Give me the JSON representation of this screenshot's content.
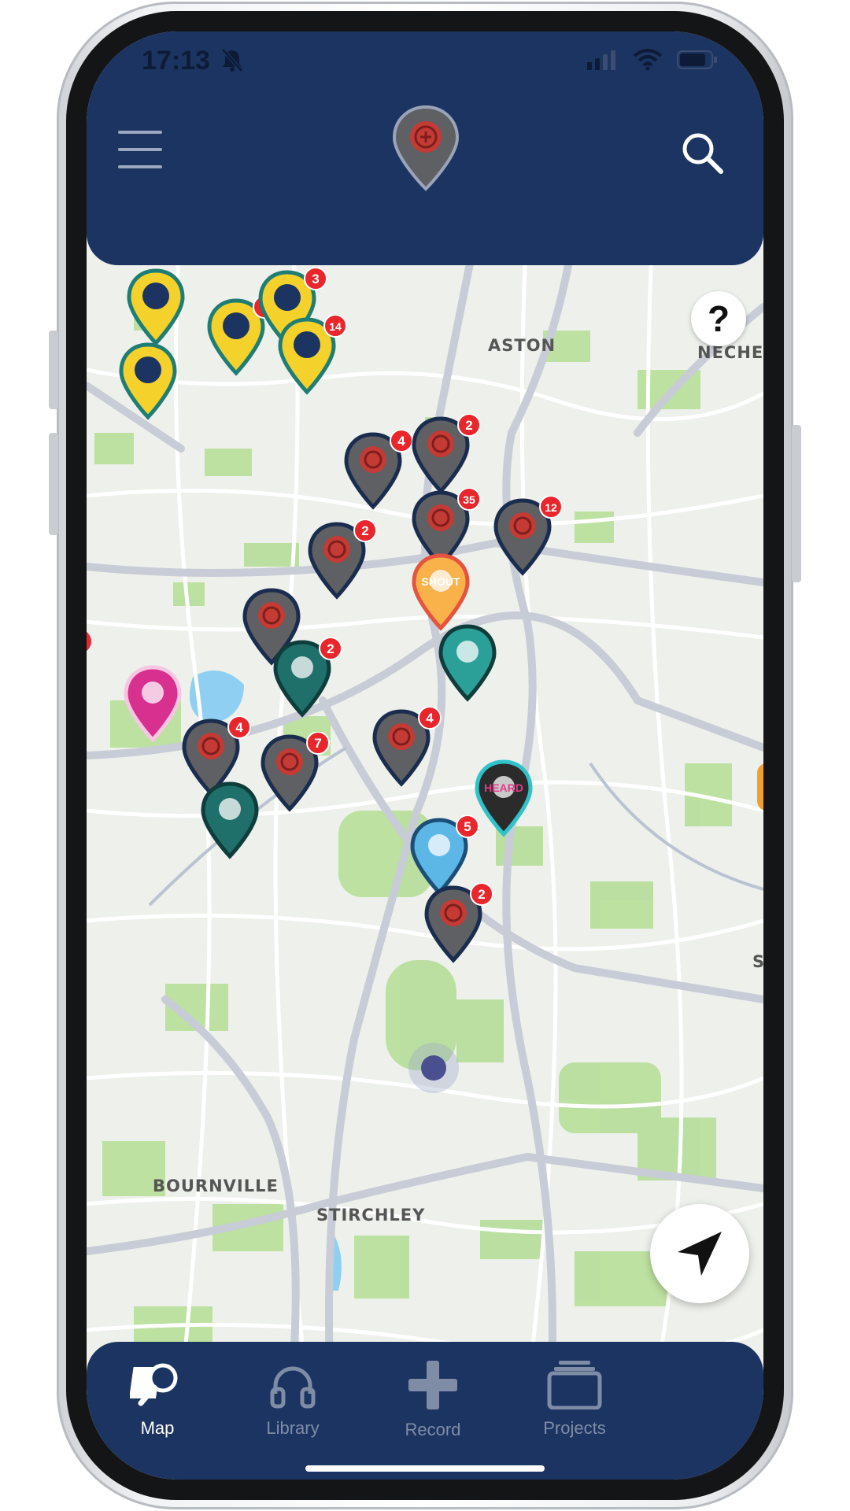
{
  "status_bar": {
    "time": "17:13"
  },
  "map": {
    "labels": [
      {
        "id": "aston",
        "text": "ASTON"
      },
      {
        "id": "nechells",
        "text": "NECHEL"
      },
      {
        "id": "bournville",
        "text": "BOURNVILLE"
      },
      {
        "id": "stirchley",
        "text": "STIRCHLEY"
      },
      {
        "id": "edge-s",
        "text": "S"
      }
    ],
    "pins": [
      {
        "id": "y1",
        "color": "#f5d22b",
        "ring": "#1f7d74",
        "count": ""
      },
      {
        "id": "y2",
        "color": "#f5d22b",
        "ring": "#1f7d74",
        "count": "7"
      },
      {
        "id": "y3",
        "color": "#f5d22b",
        "ring": "#1f7d74",
        "count": "3"
      },
      {
        "id": "y4",
        "color": "#f5d22b",
        "ring": "#1f7d74",
        "count": "14"
      },
      {
        "id": "y5",
        "color": "#f5d22b",
        "ring": "#1f7d74",
        "count": ""
      },
      {
        "id": "g1",
        "color": "#5f6063",
        "ring": "#1b2d4f",
        "count": "4"
      },
      {
        "id": "g2",
        "color": "#5f6063",
        "ring": "#1b2d4f",
        "count": "2"
      },
      {
        "id": "g3",
        "color": "#5f6063",
        "ring": "#1b2d4f",
        "count": "35"
      },
      {
        "id": "g4",
        "color": "#5f6063",
        "ring": "#1b2d4f",
        "count": "12"
      },
      {
        "id": "g5",
        "color": "#5f6063",
        "ring": "#1b2d4f",
        "count": "2"
      },
      {
        "id": "shout",
        "color": "#f9b24a",
        "ring": "#e6533f",
        "count": "",
        "text": "SHOUT"
      },
      {
        "id": "g6",
        "color": "#5f6063",
        "ring": "#1b2d4f",
        "count": ""
      },
      {
        "id": "t1",
        "color": "#1f6f6a",
        "ring": "#0f3d3b",
        "count": "2"
      },
      {
        "id": "t2",
        "color": "#2aa098",
        "ring": "#0f3d3b",
        "count": ""
      },
      {
        "id": "pink",
        "color": "#d8308f",
        "ring": "#f7c6e1",
        "count": ""
      },
      {
        "id": "g7",
        "color": "#5f6063",
        "ring": "#1b2d4f",
        "count": "4"
      },
      {
        "id": "g8",
        "color": "#5f6063",
        "ring": "#1b2d4f",
        "count": "7"
      },
      {
        "id": "g9",
        "color": "#5f6063",
        "ring": "#1b2d4f",
        "count": "4"
      },
      {
        "id": "t3",
        "color": "#1f6f6a",
        "ring": "#0f3d3b",
        "count": ""
      },
      {
        "id": "heard",
        "color": "#2b2b2b",
        "ring": "#2fc3c9",
        "count": "",
        "text": "HEARD"
      },
      {
        "id": "blue",
        "color": "#5db7e6",
        "ring": "#1b4f78",
        "count": "5"
      },
      {
        "id": "g10",
        "color": "#5f6063",
        "ring": "#1b2d4f",
        "count": "2"
      }
    ],
    "help_label": "?"
  },
  "nav": {
    "items": [
      {
        "id": "map",
        "label": "Map",
        "active": true
      },
      {
        "id": "library",
        "label": "Library",
        "active": false
      },
      {
        "id": "record",
        "label": "Record",
        "active": false
      },
      {
        "id": "projects",
        "label": "Projects",
        "active": false
      }
    ]
  },
  "colors": {
    "header_bg": "#1c3461",
    "badge": "#e8262b",
    "road": "#ffffff",
    "park": "#b9df9c",
    "water": "#8fd0f2"
  }
}
